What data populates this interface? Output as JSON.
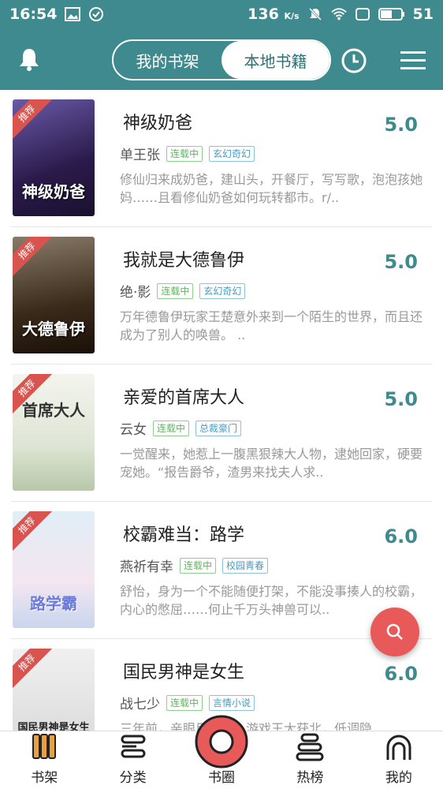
{
  "status_bar": {
    "time": "16:54",
    "network_speed": "136",
    "speed_unit": "K/s",
    "battery": "51"
  },
  "header": {
    "tabs": [
      {
        "label": "我的书架",
        "active": false
      },
      {
        "label": "本地书籍",
        "active": true
      }
    ],
    "icons": [
      "bell-icon",
      "clock-icon",
      "menu-icon"
    ]
  },
  "badge_label": "推荐",
  "books": [
    {
      "title": "神级奶爸",
      "score": "5.0",
      "author": "单王张",
      "status": "连载中",
      "genre": "玄幻奇幻",
      "desc": "修仙归来成奶爸，建山头，开餐厅，写写歌，泡泡孩她妈……且看修仙奶爸如何玩转都市。r/..",
      "cover_text": "神级奶爸",
      "cover_color": "#3a2a6a"
    },
    {
      "title": "我就是大德鲁伊",
      "score": "5.0",
      "author": "绝·影",
      "status": "连载中",
      "genre": "玄幻奇幻",
      "desc": "万年德鲁伊玩家王楚意外来到一个陌生的世界，而且还成为了别人的唤兽。 ..",
      "cover_text": "大德鲁伊",
      "cover_color": "#4a3a2a"
    },
    {
      "title": "亲爱的首席大人",
      "score": "5.0",
      "author": "云女",
      "status": "连载中",
      "genre": "总裁豪门",
      "desc": "一觉醒来，她惹上一腹黑狠辣大人物，逮她回家，硬要宠她。“报告爵爷，渣男来找夫人求..",
      "cover_text": "首席大人",
      "cover_color": "#e8eae0"
    },
    {
      "title": "校霸难当：路学",
      "score": "6.0",
      "author": "燕祈有幸",
      "status": "连载中",
      "genre": "校园青春",
      "desc": "舒怡，身为一个不能随便打架，不能没事揍人的校霸，内心的憋屈……何止千万头神兽可以..",
      "cover_text": "路学霸",
      "cover_color": "#d8e8f0"
    },
    {
      "title": "国民男神是女生",
      "score": "6.0",
      "author": "战七少",
      "status": "连载中",
      "genre": "言情小说",
      "desc": "三年前，亲眼目睹……游戏王大获北，低调隐..",
      "cover_text": "国民男神是女生",
      "cover_color": "#e6e6e6"
    }
  ],
  "bottom_nav": [
    {
      "label": "书架",
      "icon": "bookshelf-icon"
    },
    {
      "label": "分类",
      "icon": "category-icon"
    },
    {
      "label": "书圈",
      "icon": "circle-icon"
    },
    {
      "label": "热榜",
      "icon": "ranking-icon"
    },
    {
      "label": "我的",
      "icon": "profile-icon"
    }
  ],
  "colors": {
    "primary": "#3e8a8e",
    "accent": "#e85a5a",
    "score": "#3e8a8e"
  }
}
